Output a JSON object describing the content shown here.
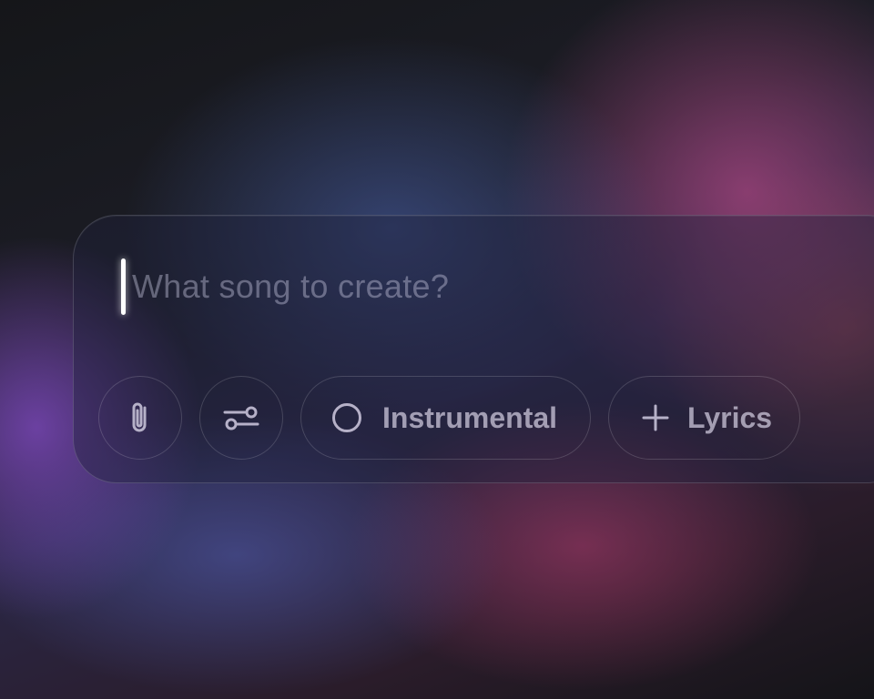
{
  "prompt": {
    "placeholder": "What song to create?"
  },
  "toolbar": {
    "attach_icon": "paperclip-icon",
    "settings_icon": "sliders-icon",
    "instrumental": {
      "label": "Instrumental",
      "icon": "toggle-circle-icon"
    },
    "lyrics": {
      "label": "Lyrics",
      "icon": "plus-icon"
    }
  },
  "colors": {
    "icon_stroke": "#b6b1c8",
    "caret": "#ffffff"
  }
}
